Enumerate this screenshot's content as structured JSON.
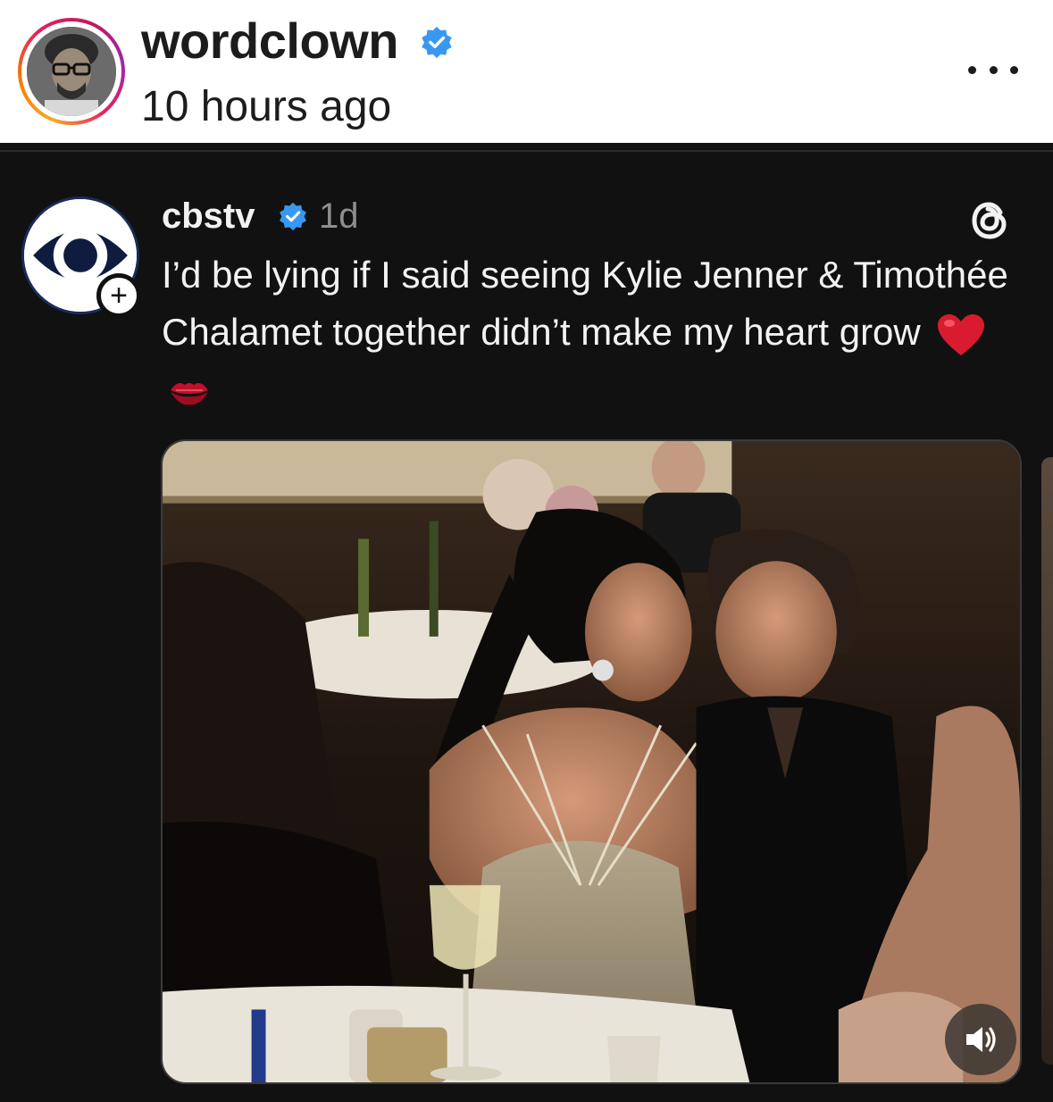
{
  "header": {
    "username": "wordclown",
    "verified": true,
    "timestamp": "10 hours ago",
    "avatar_icon": "profile-photo",
    "more_icon": "more-horizontal-icon"
  },
  "threads_post": {
    "username": "cbstv",
    "verified": true,
    "age": "1d",
    "caption": "I’d be lying if I said seeing Kylie Jenner & Timothée Chalamet together didn’t make my heart grow",
    "caption_emoji": [
      "❤️",
      "💋"
    ],
    "platform_icon": "threads-logo-icon",
    "follow_icon": "plus-icon",
    "follow_symbol": "+",
    "avatar_icon": "cbs-eye-logo"
  },
  "media": {
    "sound_icon": "speaker-icon"
  },
  "colors": {
    "background": "#111111",
    "header_bg": "#ffffff",
    "verified_blue": "#3897f0",
    "secondary_text": "#8e8e8e",
    "heart_red": "#d81b2f"
  }
}
